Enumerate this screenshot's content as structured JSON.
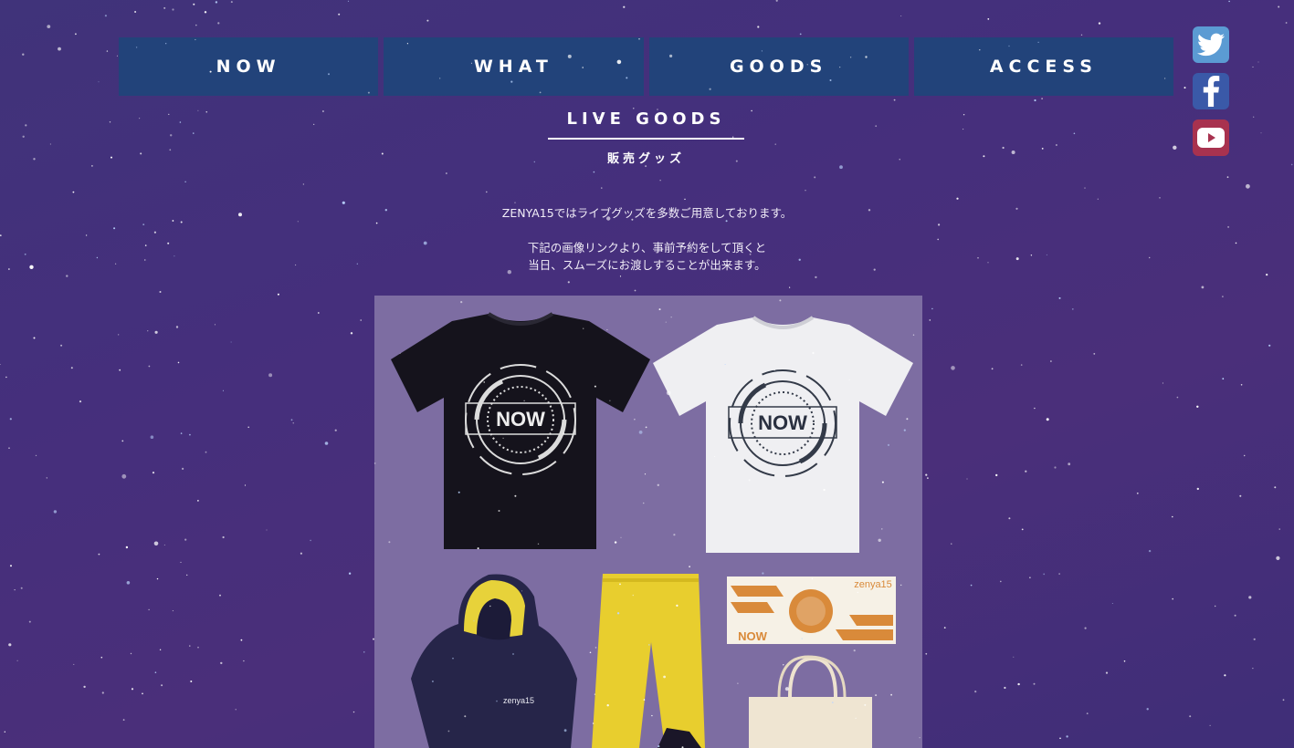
{
  "nav": {
    "items": [
      {
        "label": "NOW"
      },
      {
        "label": "WHAT"
      },
      {
        "label": "GOODS"
      },
      {
        "label": "ACCESS"
      }
    ]
  },
  "social": {
    "twitter_icon": "twitter-icon",
    "facebook_icon": "facebook-icon",
    "youtube_icon": "youtube-icon"
  },
  "section": {
    "title": "LIVE GOODS",
    "subtitle": "販売グッズ"
  },
  "intro": {
    "line1": "ZENYA15ではライブグッズを多数ご用意しております。",
    "line2": "下記の画像リンクより、事前予約をして頂くと",
    "line3": "当日、スムーズにお渡しすることが出来ます。"
  },
  "goods": {
    "tshirt_logo": "NOW",
    "towel_brand": "zenya15",
    "towel_logo": "NOW",
    "hoodie_brand": "zenya15"
  },
  "colors": {
    "background": "#452f7c",
    "nav": "#22437a",
    "goods_bg": "#7d6da2",
    "twitter": "#5b9bd3",
    "facebook": "#3a59a8",
    "youtube": "#a8324f"
  }
}
